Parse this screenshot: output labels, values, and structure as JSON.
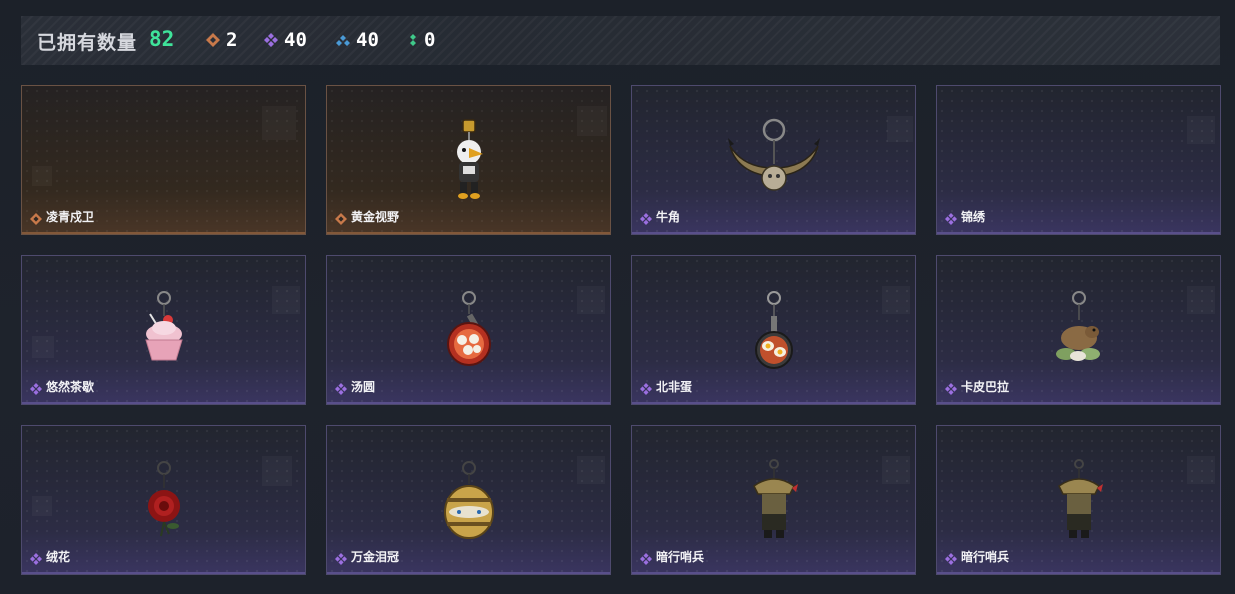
{
  "header": {
    "title": "已拥有数量",
    "total": "82",
    "stats": [
      {
        "icon": "orange-diamond-icon",
        "value": "2",
        "color": "#c8794a"
      },
      {
        "icon": "purple-diamond-icon",
        "value": "40",
        "color": "#9b6fe0"
      },
      {
        "icon": "blue-diamond-icon",
        "value": "40",
        "color": "#4a9ad6"
      },
      {
        "icon": "green-diamond-icon",
        "value": "0",
        "color": "#3fc98a"
      }
    ]
  },
  "items": [
    {
      "name": "凌青戍卫",
      "rarity": "orange",
      "icon": "none"
    },
    {
      "name": "黄金视野",
      "rarity": "orange",
      "icon": "figure-keychain"
    },
    {
      "name": "牛角",
      "rarity": "purple",
      "icon": "bull-horn-charm"
    },
    {
      "name": "锦绣",
      "rarity": "purple",
      "icon": "none"
    },
    {
      "name": "悠然茶歇",
      "rarity": "purple",
      "icon": "cupcake-charm"
    },
    {
      "name": "汤圆",
      "rarity": "purple",
      "icon": "soup-bowl-charm"
    },
    {
      "name": "北非蛋",
      "rarity": "purple",
      "icon": "egg-pan-charm"
    },
    {
      "name": "卡皮巴拉",
      "rarity": "purple",
      "icon": "capybara-charm"
    },
    {
      "name": "绒花",
      "rarity": "purple",
      "icon": "rose-charm"
    },
    {
      "name": "万金泪冠",
      "rarity": "purple",
      "icon": "jeweled-egg-charm"
    },
    {
      "name": "暗行哨兵",
      "rarity": "purple",
      "icon": "sentinel-charm"
    },
    {
      "name": "暗行哨兵",
      "rarity": "purple",
      "icon": "sentinel-charm"
    }
  ]
}
